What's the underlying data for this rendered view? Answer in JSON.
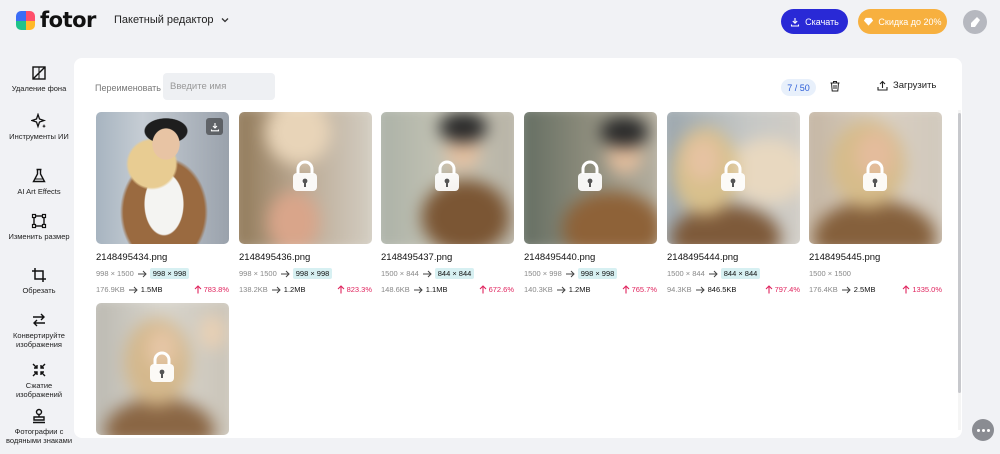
{
  "app": {
    "brand": "fotor",
    "mode_label": "Пакетный редактор",
    "download_label": "Скачать",
    "discount_label": "Скидка до 20%",
    "colors": {
      "accent": "#2929d6",
      "discount": "#f7b03f",
      "increase": "#e0245e",
      "highlight": "#d7f0f2"
    }
  },
  "sidebar": {
    "items": [
      {
        "icon": "remove-background-icon",
        "label": "Удаление фона"
      },
      {
        "icon": "ai-tools-icon",
        "label": "Инструменты ИИ"
      },
      {
        "icon": "ai-art-effects-icon",
        "label": "AI Art Effects"
      },
      {
        "icon": "resize-icon",
        "label": "Изменить размер"
      },
      {
        "icon": "crop-icon",
        "label": "Обрезать"
      },
      {
        "icon": "convert-icon",
        "label": "Конвертируйте изображения"
      },
      {
        "icon": "compress-icon",
        "label": "Сжатие изображений"
      },
      {
        "icon": "watermark-icon",
        "label": "Фотографии с водяными знаками"
      }
    ]
  },
  "toolbar": {
    "rename_label": "Переименовать",
    "rename_placeholder": "Введите имя",
    "counter": "7 / 50",
    "upload_label": "Загрузить"
  },
  "images": [
    {
      "name": "2148495434.png",
      "old_dim": "998 × 1500",
      "new_dim": "998 × 998",
      "old_size": "176.9KB",
      "new_size": "1.5MB",
      "increase": "783.8%",
      "locked": false
    },
    {
      "name": "2148495436.png",
      "old_dim": "998 × 1500",
      "new_dim": "998 × 998",
      "old_size": "138.2KB",
      "new_size": "1.2MB",
      "increase": "823.3%",
      "locked": true
    },
    {
      "name": "2148495437.png",
      "old_dim": "1500 × 844",
      "new_dim": "844 × 844",
      "old_size": "148.6KB",
      "new_size": "1.1MB",
      "increase": "672.6%",
      "locked": true
    },
    {
      "name": "2148495440.png",
      "old_dim": "1500 × 998",
      "new_dim": "998 × 998",
      "old_size": "140.3KB",
      "new_size": "1.2MB",
      "increase": "765.7%",
      "locked": true
    },
    {
      "name": "2148495444.png",
      "old_dim": "1500 × 844",
      "new_dim": "844 × 844",
      "old_size": "94.3KB",
      "new_size": "846.5KB",
      "increase": "797.4%",
      "locked": true
    },
    {
      "name": "2148495445.png",
      "old_dim": "1500 × 1500",
      "new_dim": "",
      "old_size": "176.4KB",
      "new_size": "2.5MB",
      "increase": "1335.0%",
      "locked": true
    },
    {
      "name": "",
      "old_dim": "",
      "new_dim": "",
      "old_size": "",
      "new_size": "",
      "increase": "",
      "locked": true
    }
  ]
}
